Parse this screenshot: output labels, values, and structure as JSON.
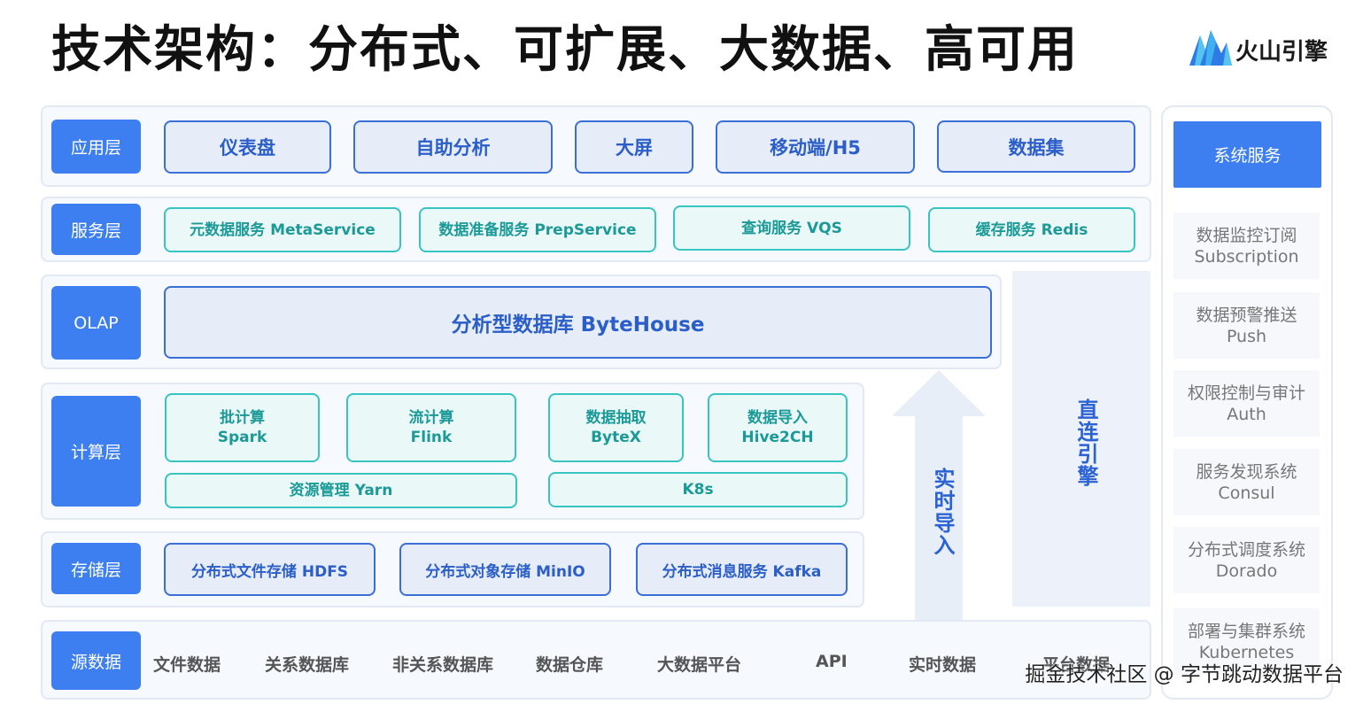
{
  "title": "技术架构：分布式、可扩展、大数据、高可用",
  "logo": {
    "text": "火山引擎"
  },
  "layers": {
    "app": {
      "label": "应用层",
      "items": [
        "仪表盘",
        "自助分析",
        "大屏",
        "移动端/H5",
        "数据集"
      ]
    },
    "service": {
      "label": "服务层",
      "items": [
        "元数据服务 MetaService",
        "数据准备服务 PrepService",
        "查询服务 VQS",
        "缓存服务 Redis"
      ]
    },
    "olap": {
      "label": "OLAP",
      "item": "分析型数据库 ByteHouse"
    },
    "compute": {
      "label": "计算层",
      "batch": {
        "line1": "批计算",
        "line2": "Spark"
      },
      "stream": {
        "line1": "流计算",
        "line2": "Flink"
      },
      "extract": {
        "line1": "数据抽取",
        "line2": "ByteX"
      },
      "import": {
        "line1": "数据导入",
        "line2": "Hive2CH"
      },
      "yarn": "资源管理 Yarn",
      "k8s": "K8s"
    },
    "storage": {
      "label": "存储层",
      "items": [
        "分布式文件存储 HDFS",
        "分布式对象存储 MinIO",
        "分布式消息服务 Kafka"
      ]
    },
    "source": {
      "label": "源数据",
      "items": [
        "文件数据",
        "关系数据库",
        "非关系数据库",
        "数据仓库",
        "大数据平台",
        "API",
        "实时数据",
        "平台数据"
      ]
    }
  },
  "realtime_import": "实时导入",
  "direct_engine": "直连引擎",
  "system": {
    "header": "系统服务",
    "items": [
      {
        "zh": "数据监控订阅",
        "en": "Subscription"
      },
      {
        "zh": "数据预警推送",
        "en": "Push"
      },
      {
        "zh": "权限控制与审计",
        "en": "Auth"
      },
      {
        "zh": "服务发现系统",
        "en": "Consul"
      },
      {
        "zh": "分布式调度系统",
        "en": "Dorado"
      },
      {
        "zh": "部署与集群系统",
        "en": "Kubernetes"
      }
    ]
  },
  "watermark": "掘金技术社区 @ 字节跳动数据平台",
  "colors": {
    "accent": "#3d7ff0",
    "blue_border": "#3a6fd8",
    "teal_border": "#38c4c0",
    "text_blue": "#2b5ec8",
    "text_teal": "#1b9a98"
  }
}
